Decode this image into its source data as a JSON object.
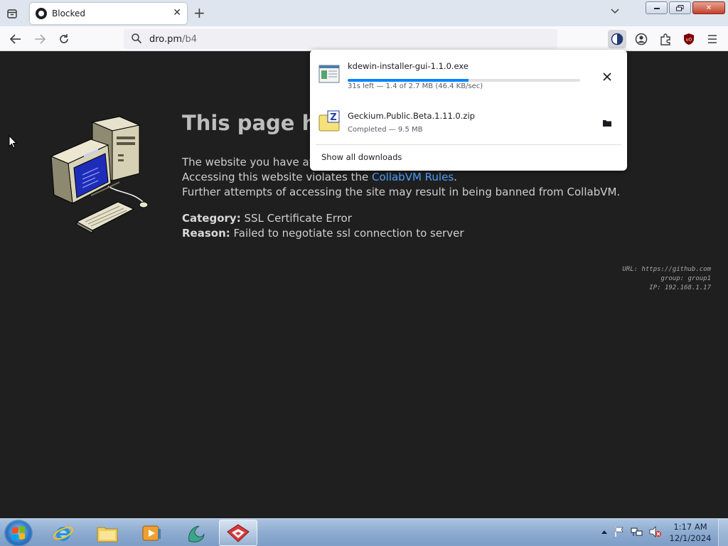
{
  "browser": {
    "tab": {
      "title": "Blocked",
      "favicon": "github-icon"
    },
    "url": {
      "host": "dro.pm",
      "path": "/b4"
    },
    "toolbar_icons": [
      "contrast-icon",
      "account-icon",
      "extensions-icon",
      "ublock-icon",
      "menu-icon"
    ]
  },
  "page": {
    "heading": "This page ha",
    "paragraph": {
      "line1": "The website you have atte",
      "line2_prefix": "Accessing this website violates the ",
      "line2_link": "CollabVM Rules",
      "line2_suffix": ".",
      "line3": "Further attempts of accessing the site may result in being banned from CollabVM."
    },
    "category_label": "Category:",
    "category_value": " SSL Certificate Error",
    "reason_label": "Reason:",
    "reason_value": " Failed to negotiate ssl connection to server",
    "info": {
      "url": "URL: https://github.com",
      "group": "group: group1",
      "ip": "IP: 192.168.1.17"
    }
  },
  "downloads": {
    "items": [
      {
        "name": "kdewin-installer-gui-1.1.0.exe",
        "status": "31s left — 1.4 of 2.7 MB (46.4 KB/sec)",
        "progress": 0.52,
        "action": "cancel-icon"
      },
      {
        "name": "Geckium.Public.Beta.1.11.0.zip",
        "status": "Completed — 9.5 MB",
        "action": "folder-icon"
      }
    ],
    "show_all": "Show all downloads"
  },
  "taskbar": {
    "apps": [
      "internet-explorer-icon",
      "file-explorer-icon",
      "media-player-icon",
      "app-icon",
      "browser-icon"
    ],
    "time": "1:17 AM",
    "date": "12/1/2024"
  },
  "colors": {
    "accent": "#0a84ff",
    "link": "#4ea1ff",
    "page_bg": "#1f1f1f"
  }
}
